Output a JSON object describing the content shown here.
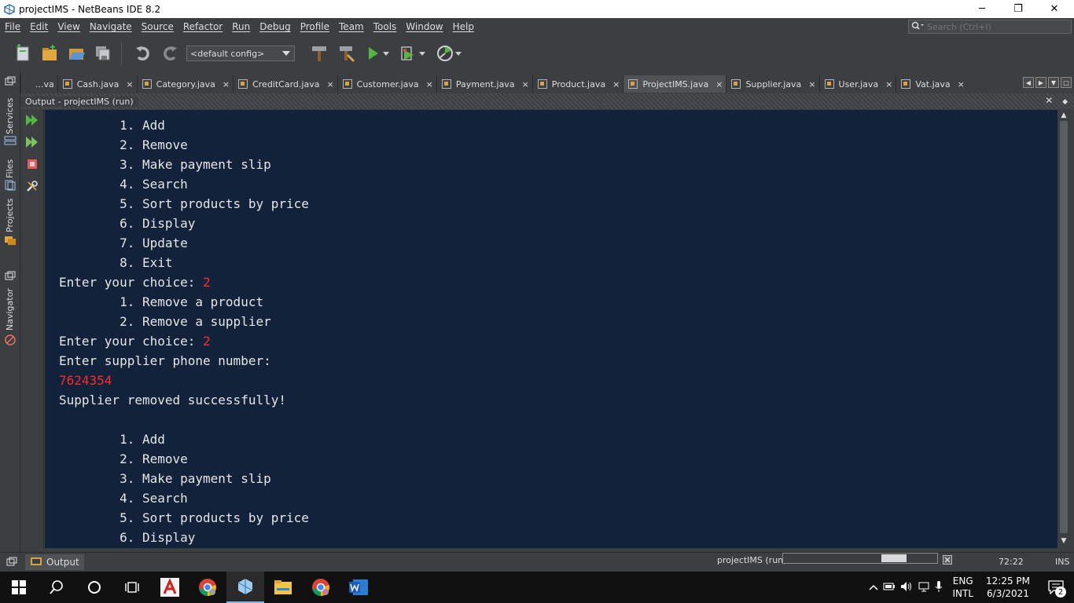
{
  "window": {
    "title": "projectIMS - NetBeans IDE 8.2",
    "minimize": "─",
    "restore": "❐",
    "close": "✕"
  },
  "menu": [
    "File",
    "Edit",
    "View",
    "Navigate",
    "Source",
    "Refactor",
    "Run",
    "Debug",
    "Profile",
    "Team",
    "Tools",
    "Window",
    "Help"
  ],
  "search": {
    "placeholder": "Search (Ctrl+I)"
  },
  "toolbar": {
    "config": "<default config>"
  },
  "tabs": {
    "items": [
      "...va",
      "Cash.java",
      "Category.java",
      "CreditCard.java",
      "Customer.java",
      "Payment.java",
      "Product.java",
      "ProjectIMS.java",
      "Supplier.java",
      "User.java",
      "Vat.java"
    ],
    "active": "ProjectIMS.java",
    "close": "×"
  },
  "side_labels": {
    "services": "Services",
    "files": "Files",
    "projects": "Projects",
    "navigator": "Navigator"
  },
  "output": {
    "header": "Output - projectIMS (run)",
    "lines": [
      {
        "text": "        1. Add"
      },
      {
        "text": "        2. Remove"
      },
      {
        "text": "        3. Make payment slip"
      },
      {
        "text": "        4. Search"
      },
      {
        "text": "        5. Sort products by price"
      },
      {
        "text": "        6. Display"
      },
      {
        "text": "        7. Update"
      },
      {
        "text": "        8. Exit"
      },
      {
        "text": "Enter your choice: ",
        "input": "2"
      },
      {
        "text": "        1. Remove a product"
      },
      {
        "text": "        2. Remove a supplier"
      },
      {
        "text": "Enter your choice: ",
        "input": "2"
      },
      {
        "text": "Enter supplier phone number:"
      },
      {
        "text": "",
        "input": "7624354"
      },
      {
        "text": "Supplier removed successfully!"
      },
      {
        "text": ""
      },
      {
        "text": "        1. Add"
      },
      {
        "text": "        2. Remove"
      },
      {
        "text": "        3. Make payment slip"
      },
      {
        "text": "        4. Search"
      },
      {
        "text": "        5. Sort products by price"
      },
      {
        "text": "        6. Display"
      }
    ]
  },
  "status": {
    "output_tab": "Output",
    "run_label": "projectIMS (run)",
    "position": "72:22",
    "mode": "INS"
  },
  "tray": {
    "lang_top": "ENG",
    "lang_bottom": "INTL",
    "time": "12:25 PM",
    "date": "6/3/2021",
    "notifications": "2"
  }
}
